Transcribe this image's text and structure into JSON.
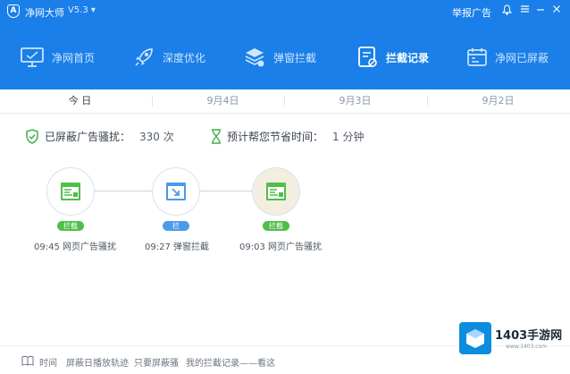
{
  "titlebar": {
    "app_name": "净网大师",
    "version": "V5.3 ▾",
    "report_label": "举报广告",
    "icons": [
      "bell-icon",
      "menu-icon",
      "minimize-icon",
      "close-icon"
    ]
  },
  "nav": {
    "items": [
      {
        "label": "净网首页",
        "icon": "monitor-icon"
      },
      {
        "label": "深度优化",
        "icon": "rocket-icon"
      },
      {
        "label": "弹窗拦截",
        "icon": "layers-icon"
      },
      {
        "label": "拦截记录",
        "icon": "record-icon"
      },
      {
        "label": "净网已屏蔽",
        "icon": "calendar-icon"
      }
    ],
    "active_index": 3
  },
  "subtabs": [
    "今 日",
    "9月4日",
    "9月3日",
    "9月2日"
  ],
  "stats": {
    "blocked_label": "已屏蔽广告骚扰：",
    "blocked_value": "330 次",
    "saved_label": "预计帮您节省时间：",
    "saved_value": "1 分钟"
  },
  "timeline": [
    {
      "time_label": "09:45 网页广告骚扰",
      "badge": "拦截",
      "badge_color": "#4fbe4a",
      "icon": "webpage-ad-icon"
    },
    {
      "time_label": "09:27 弹窗拦截",
      "badge": "拦",
      "badge_color": "#4a9be8",
      "icon": "popup-block-icon"
    },
    {
      "time_label": "09:03 网页广告骚扰",
      "badge": "拦截",
      "badge_color": "#4fbe4a",
      "icon": "webpage-ad-icon"
    }
  ],
  "footer": {
    "items": [
      "时间",
      "屏蔽日播放轨迹",
      "只要屏蔽骚",
      "我的拦截记录——看这"
    ]
  },
  "watermark": {
    "brand": "1403手游网",
    "url": "www.1403.com"
  }
}
